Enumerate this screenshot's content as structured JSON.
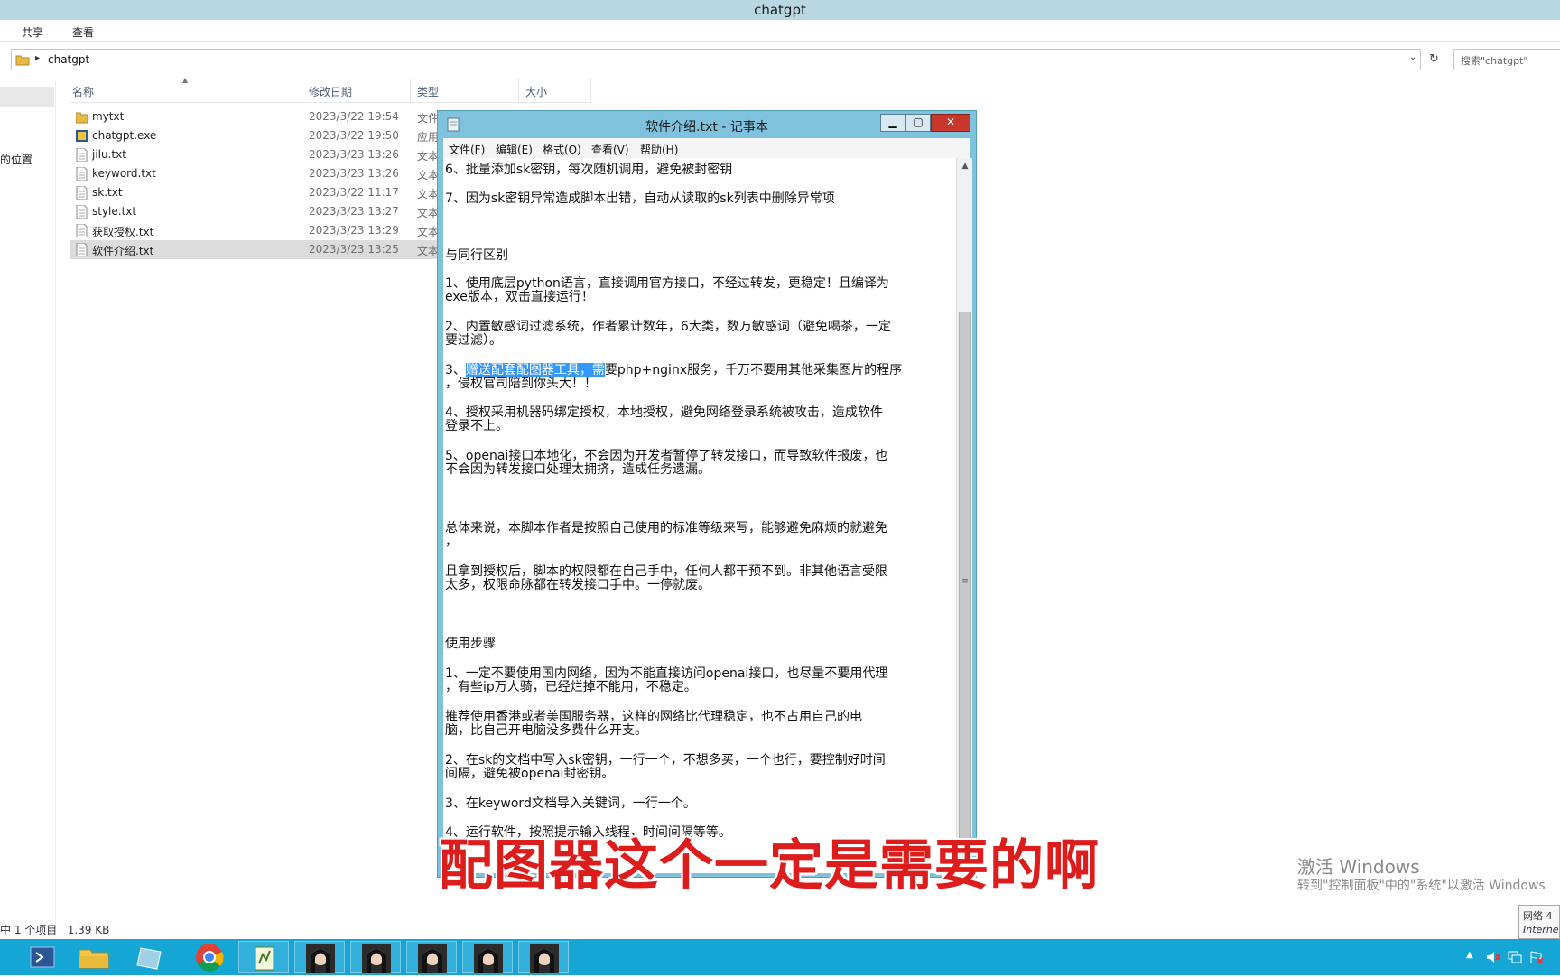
{
  "explorer": {
    "title": "chatgpt",
    "ribbon_tabs": [
      "共享",
      "查看"
    ],
    "address": "chatgpt",
    "search_placeholder": "搜索\"chatgpt\"",
    "nav_location": "的位置",
    "columns": [
      "名称",
      "修改日期",
      "类型",
      "大小"
    ],
    "files": [
      {
        "name": "mytxt",
        "date": "2023/3/22 19:54",
        "type": "文件",
        "icon": "folder-icon"
      },
      {
        "name": "chatgpt.exe",
        "date": "2023/3/22 19:50",
        "type": "应用",
        "icon": "exe-icon"
      },
      {
        "name": "jilu.txt",
        "date": "2023/3/23 13:26",
        "type": "文本",
        "icon": "text-file-icon"
      },
      {
        "name": "keyword.txt",
        "date": "2023/3/23 13:26",
        "type": "文本",
        "icon": "text-file-icon"
      },
      {
        "name": "sk.txt",
        "date": "2023/3/22 11:17",
        "type": "文本",
        "icon": "text-file-icon"
      },
      {
        "name": "style.txt",
        "date": "2023/3/23 13:27",
        "type": "文本",
        "icon": "text-file-icon"
      },
      {
        "name": "获取授权.txt",
        "date": "2023/3/23 13:29",
        "type": "文本",
        "icon": "text-file-icon"
      },
      {
        "name": "软件介绍.txt",
        "date": "2023/3/23 13:25",
        "type": "文本",
        "icon": "text-file-icon",
        "selected": true
      }
    ],
    "status": {
      "count": "中 1 个项目",
      "size": "1.39 KB"
    }
  },
  "notepad": {
    "title": "软件介绍.txt - 记事本",
    "menu": [
      "文件(F)",
      "编辑(E)",
      "格式(O)",
      "查看(V)",
      "帮助(H)"
    ],
    "lines": [
      "6、批量添加sk密钥，每次随机调用，避免被封密钥",
      "7、因为sk密钥异常造成脚本出错，自动从读取的sk列表中删除异常项",
      "与同行区别",
      "1、使用底层python语言，直接调用官方接口，不经过转发，更稳定！且编译为",
      "exe版本，双击直接运行！",
      "2、内置敏感词过滤系统，作者累计数年，6大类，数万敏感词（避免喝茶，一定",
      "要过滤）。",
      "3、",
      "，侵权官司陪到你头大！！",
      "4、授权采用机器码绑定授权，本地授权，避免网络登录系统被攻击，造成软件",
      "登录不上。",
      "5、openai接口本地化，不会因为开发者暂停了转发接口，而导致软件报废，也",
      "不会因为转发接口处理太拥挤，造成任务遗漏。",
      "总体来说，本脚本作者是按照自己使用的标准等级来写，能够避免麻烦的就避免",
      "，",
      "且拿到授权后，脚本的权限都在自己手中，任何人都干预不到。非其他语言受限",
      "太多，权限命脉都在转发接口手中。一停就废。",
      "使用步骤",
      "1、一定不要使用国内网络，因为不能直接访问openai接口，也尽量不要用代理",
      "，有些ip万人骑，已经烂掉不能用，不稳定。",
      "    推荐使用香港或者美国服务器，这样的网络比代理稳定，也不占用自己的电",
      "脑，比自己开电脑没多费什么开支。",
      "2、在sk的文档中写入sk密钥，一行一个，不想多买，一个也行，要控制好时间",
      "间隔，避免被openai封密钥。",
      "3、在keyword文档导入关键词，一行一个。",
      "4、运行软件，按照提示输入线程，时间间隔等等。"
    ],
    "line3_highlight": "赠送配套配图器工具，需",
    "line3_rest": "要php+nginx服务，千万不要用其他采集图片的程序"
  },
  "caption": "配图器这个一定是需要的啊",
  "watermark": {
    "line1": "激活 Windows",
    "line2": "转到\"控制面板\"中的\"系统\"以激活 Windows"
  },
  "tray_tooltip": {
    "line1": "网络 4",
    "line2": "Interne"
  },
  "colors": {
    "taskbar": "#16a6d6",
    "caption": "#dd1c1c",
    "notepad_frame": "#7ec2de",
    "selection": "#3399ff"
  }
}
